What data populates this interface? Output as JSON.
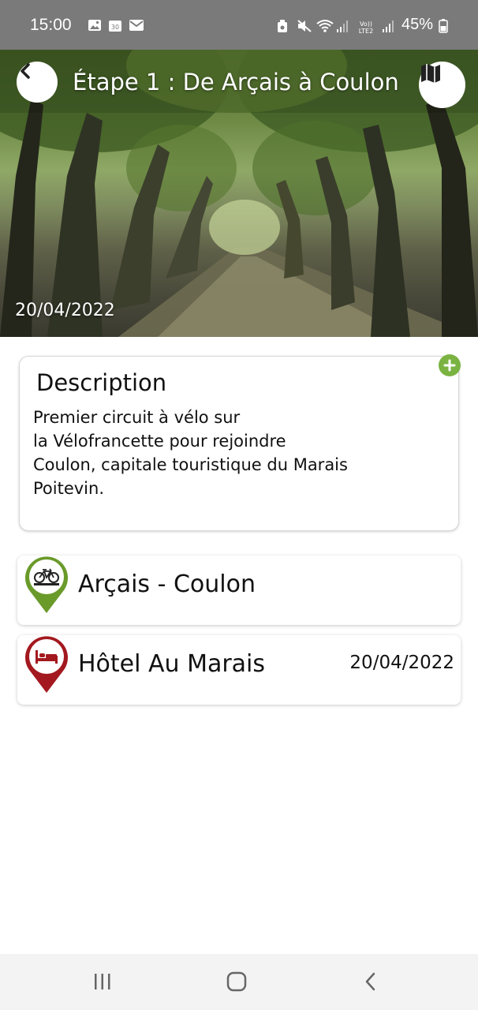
{
  "status_bar": {
    "time": "15:00",
    "battery_percent": "45%",
    "left_icons": [
      "image-icon",
      "calendar-icon",
      "mail-icon"
    ],
    "right_icons": [
      "shield-icon",
      "mute-icon",
      "wifi-icon",
      "signal-icon",
      "volte-icon",
      "signal-icon",
      "battery-icon"
    ],
    "volte_label": "VoLTE2"
  },
  "header": {
    "title": "Étape  1 : De Arçais à Coulon",
    "date": "20/04/2022",
    "back_icon": "chevron-left-icon",
    "map_icon": "map-icon"
  },
  "description": {
    "title": "Description",
    "lines": [
      "Premier circuit à vélo sur",
      "la Vélofrancette pour rejoindre",
      "Coulon, capitale touristique du Marais",
      "Poitevin."
    ],
    "add_icon": "plus-icon"
  },
  "items": [
    {
      "label": "Arçais - Coulon",
      "icon": "bicycle-icon",
      "pin_color": "#6a9a2a",
      "date": ""
    },
    {
      "label": "Hôtel Au Marais",
      "icon": "bed-icon",
      "pin_color": "#a3191f",
      "date": "20/04/2022"
    }
  ],
  "nav": {
    "recents_icon": "recents-icon",
    "home_icon": "home-icon",
    "back_icon": "back-icon"
  },
  "colors": {
    "accent_green": "#7ab342",
    "status_bar": "#7a7a7a"
  }
}
